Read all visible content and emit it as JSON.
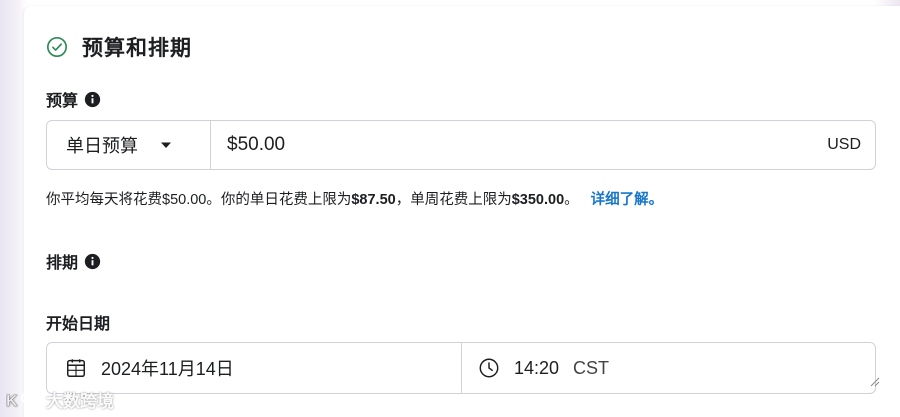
{
  "section": {
    "title": "预算和排期",
    "icon": "check-circle-icon"
  },
  "budget": {
    "label": "预算",
    "type_label": "单日预算",
    "amount": "$50.00",
    "currency": "USD"
  },
  "help": {
    "part1": "你平均每天将花费$50.00。你的单日花费上限为",
    "daily_cap": "$87.50",
    "part2": "，单周花费上限为",
    "weekly_cap": "$350.00",
    "part3": "。",
    "link": "详细了解。"
  },
  "schedule": {
    "label": "排期"
  },
  "start": {
    "label": "开始日期",
    "date": "2024年11月14日",
    "time": "14:20",
    "timezone": "CST"
  },
  "watermark": {
    "text": "大数跨境"
  },
  "colors": {
    "accent_green": "#2e8b57",
    "link_blue": "#1877c9",
    "border": "#cfd3d9"
  }
}
